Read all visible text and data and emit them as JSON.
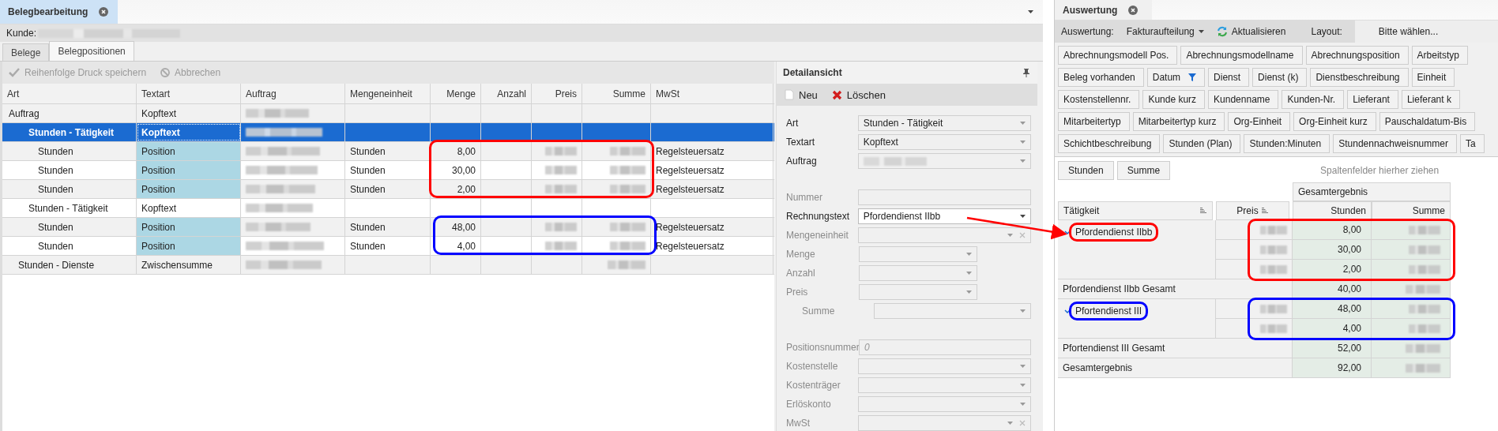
{
  "left_panel": {
    "tab": {
      "title": "Belegbearbeitung"
    },
    "customer_label": "Kunde:",
    "subtabs": [
      {
        "label": "Belege",
        "selected": false
      },
      {
        "label": "Belegpositionen",
        "selected": true
      }
    ],
    "toolbar": [
      {
        "kind": "save",
        "label": "Reihenfolge Druck speichern",
        "disabled": true
      },
      {
        "kind": "cancel",
        "label": "Abbrechen",
        "disabled": true
      }
    ],
    "table": {
      "columns": [
        "Art",
        "Textart",
        "Auftrag",
        "Mengeneinheit",
        "Menge",
        "Anzahl",
        "Preis",
        "Summe",
        "MwSt"
      ],
      "rows": [
        {
          "kind": "header",
          "art": "Auftrag",
          "textart": "Kopftext",
          "selected": false
        },
        {
          "kind": "group",
          "art": "Stunden - Tätigkeit",
          "textart": "Kopftext",
          "selected": true
        },
        {
          "kind": "position",
          "art": "Stunden",
          "textart": "Position",
          "mengeneinheit": "Stunden",
          "menge": "8,00",
          "mwst": "Regelsteuersatz",
          "selected": false
        },
        {
          "kind": "position",
          "art": "Stunden",
          "textart": "Position",
          "mengeneinheit": "Stunden",
          "menge": "30,00",
          "mwst": "Regelsteuersatz",
          "selected": false
        },
        {
          "kind": "position",
          "art": "Stunden",
          "textart": "Position",
          "mengeneinheit": "Stunden",
          "menge": "2,00",
          "mwst": "Regelsteuersatz",
          "selected": false
        },
        {
          "kind": "group",
          "art": "Stunden - Tätigkeit",
          "textart": "Kopftext",
          "selected": false
        },
        {
          "kind": "position",
          "art": "Stunden",
          "textart": "Position",
          "mengeneinheit": "Stunden",
          "menge": "48,00",
          "mwst": "Regelsteuersatz",
          "selected": false
        },
        {
          "kind": "position",
          "art": "Stunden",
          "textart": "Position",
          "mengeneinheit": "Stunden",
          "menge": "4,00",
          "mwst": "Regelsteuersatz",
          "selected": false
        },
        {
          "kind": "subtotal",
          "art": "Stunden - Dienste",
          "textart": "Zwischensumme",
          "selected": false
        }
      ]
    }
  },
  "detail": {
    "title": "Detailansicht",
    "toolbar": [
      {
        "kind": "new",
        "label": "Neu"
      },
      {
        "kind": "delete",
        "label": "Löschen"
      }
    ],
    "field_groups": [
      [
        {
          "kind": "combo",
          "label": "Art",
          "value": "Stunden - Tätigkeit",
          "disabled": false,
          "editable": false
        },
        {
          "kind": "combo",
          "label": "Textart",
          "value": "Kopftext",
          "disabled": false,
          "editable": false
        },
        {
          "kind": "combo",
          "label": "Auftrag",
          "disabled": false,
          "editable": false,
          "blurred": true
        }
      ],
      [
        {
          "kind": "text",
          "label": "Nummer",
          "disabled": true,
          "editable": false
        },
        {
          "kind": "combo",
          "label": "Rechnungstext",
          "value": "Pfordendienst IIbb",
          "disabled": false,
          "editable": true
        },
        {
          "kind": "combo",
          "label": "Mengeneinheit",
          "disabled": true,
          "editable": false,
          "clearable": true
        },
        {
          "kind": "shortcombo",
          "label": "Menge",
          "disabled": true,
          "editable": false
        },
        {
          "kind": "shortcombo",
          "label": "Anzahl",
          "disabled": true,
          "editable": false
        },
        {
          "kind": "shortcombo",
          "label": "Preis",
          "disabled": true,
          "editable": false
        },
        {
          "kind": "subcombo",
          "label": "Summe",
          "disabled": true,
          "editable": false
        }
      ],
      [
        {
          "kind": "text",
          "label": "Positionsnummer",
          "placeholder": "0",
          "disabled": true,
          "editable": false
        },
        {
          "kind": "combo",
          "label": "Kostenstelle",
          "disabled": true,
          "editable": false
        },
        {
          "kind": "combo",
          "label": "Kostenträger",
          "disabled": true,
          "editable": false
        },
        {
          "kind": "combo",
          "label": "Erlöskonto",
          "disabled": true,
          "editable": false
        },
        {
          "kind": "combo",
          "label": "MwSt",
          "disabled": true,
          "editable": false,
          "clearable": true
        }
      ]
    ]
  },
  "right_panel": {
    "tab": {
      "title": "Auswertung"
    },
    "toolbar": {
      "report_label": "Auswertung:",
      "report": "Fakturaufteilung",
      "refresh": "Aktualisieren",
      "layout_label": "Layout:",
      "layout_value": "Bitte wählen..."
    },
    "field_rows": [
      [
        {
          "label": "Abrechnungsmodell Pos."
        },
        {
          "label": "Abrechnungsmodellname"
        },
        {
          "label": "Abrechnungsposition"
        },
        {
          "label": "Arbeitstyp"
        }
      ],
      [
        {
          "label": "Beleg vorhanden"
        },
        {
          "label": "Datum",
          "filtered": true
        },
        {
          "label": "Dienst"
        },
        {
          "label": "Dienst (k)"
        },
        {
          "label": "Dienstbeschreibung"
        },
        {
          "label": "Einheit"
        }
      ],
      [
        {
          "label": "Kostenstellennr."
        },
        {
          "label": "Kunde kurz"
        },
        {
          "label": "Kundenname"
        },
        {
          "label": "Kunden-Nr."
        },
        {
          "label": "Lieferant"
        },
        {
          "label": "Lieferant k"
        }
      ],
      [
        {
          "label": "Mitarbeitertyp"
        },
        {
          "label": "Mitarbeitertyp kurz"
        },
        {
          "label": "Org-Einheit"
        },
        {
          "label": "Org-Einheit kurz"
        },
        {
          "label": "Pauschaldatum-Bis"
        }
      ],
      [
        {
          "label": "Schichtbeschreibung"
        },
        {
          "label": "Stunden (Plan)"
        },
        {
          "label": "Stunden:Minuten"
        },
        {
          "label": "Stundennachweisnummer"
        },
        {
          "label": "Ta"
        }
      ]
    ],
    "pivot": {
      "data_fields": [
        "Stunden",
        "Summe"
      ],
      "column_hint": "Spaltenfelder hierher ziehen",
      "column_total": "Gesamtergebnis",
      "value_columns": [
        "Stunden",
        "Summe"
      ],
      "row_fields": [
        "Tätigkeit",
        "Preis"
      ],
      "groups": [
        {
          "name": "Pfordendienst IIbb",
          "expanded": true,
          "rows": [
            {
              "stunden": "8,00"
            },
            {
              "stunden": "30,00"
            },
            {
              "stunden": "2,00"
            }
          ],
          "total_label": "Pfordendienst IIbb Gesamt",
          "total": "40,00"
        },
        {
          "name": "Pfortendienst III",
          "expanded": true,
          "rows": [
            {
              "stunden": "48,00"
            },
            {
              "stunden": "4,00"
            }
          ],
          "total_label": "Pfortendienst III Gesamt",
          "total": "52,00"
        }
      ],
      "grand_total_label": "Gesamtergebnis",
      "grand_total": "92,00"
    }
  },
  "annotations": [
    {
      "kind": "tablebox",
      "color": "#ff0000"
    },
    {
      "kind": "tablebox",
      "color": "#0000ff"
    },
    {
      "kind": "arrow",
      "color": "#ff0000"
    },
    {
      "kind": "namebox",
      "color": "#ff0000"
    },
    {
      "kind": "valuesbox",
      "color": "#ff0000"
    },
    {
      "kind": "namebox",
      "color": "#0000ff"
    },
    {
      "kind": "valuesbox",
      "color": "#0000ff"
    }
  ]
}
